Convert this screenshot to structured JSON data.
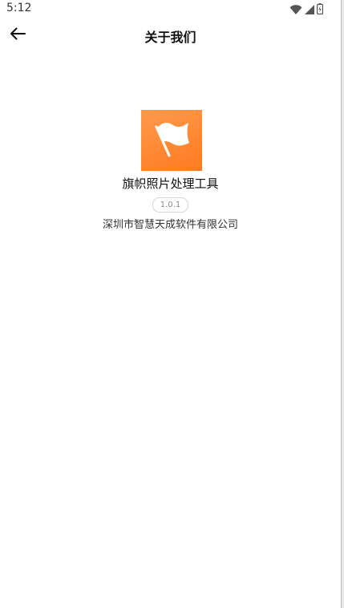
{
  "status_bar": {
    "time": "5:12",
    "icons": [
      "wifi-icon",
      "signal-icon",
      "battery-icon"
    ]
  },
  "header": {
    "title": "关于我们",
    "back_icon": "arrow-left-icon"
  },
  "about": {
    "logo_icon": "flag-icon",
    "app_name": "旗帜照片处理工具",
    "version": "1.0.1",
    "company": "深圳市智慧天成软件有限公司"
  },
  "colors": {
    "logo_gradient_start": "#ff9a4a",
    "logo_gradient_end": "#ff7a22",
    "background": "#ffffff"
  }
}
